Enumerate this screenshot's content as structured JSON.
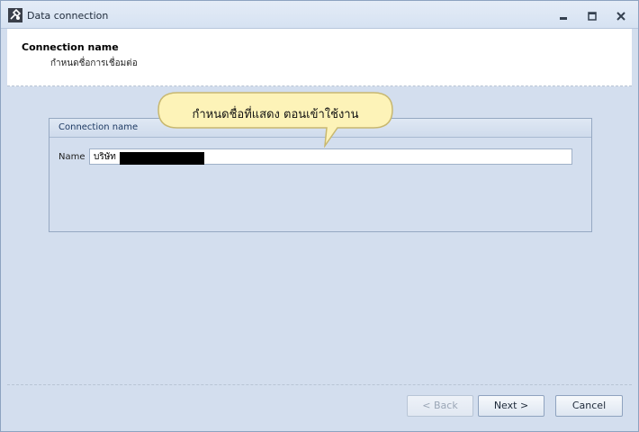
{
  "window": {
    "title": "Data connection",
    "icon": "app-tool-icon"
  },
  "header": {
    "title": "Connection name",
    "subtitle": "กำหนดชื่อการเชื่อมต่อ"
  },
  "tooltip": {
    "text": "กำหนดชื่อที่แสดง ตอนเข้าใช้งาน"
  },
  "group": {
    "title": "Connection name",
    "name_label": "Name",
    "name_value": "บริษัท"
  },
  "buttons": {
    "back": "< Back",
    "next": "Next >",
    "cancel": "Cancel"
  },
  "colors": {
    "window_bg": "#d3deee",
    "header_bg": "#ffffff",
    "tooltip_fill": "#fdf3b8",
    "tooltip_border": "#c8b870"
  }
}
